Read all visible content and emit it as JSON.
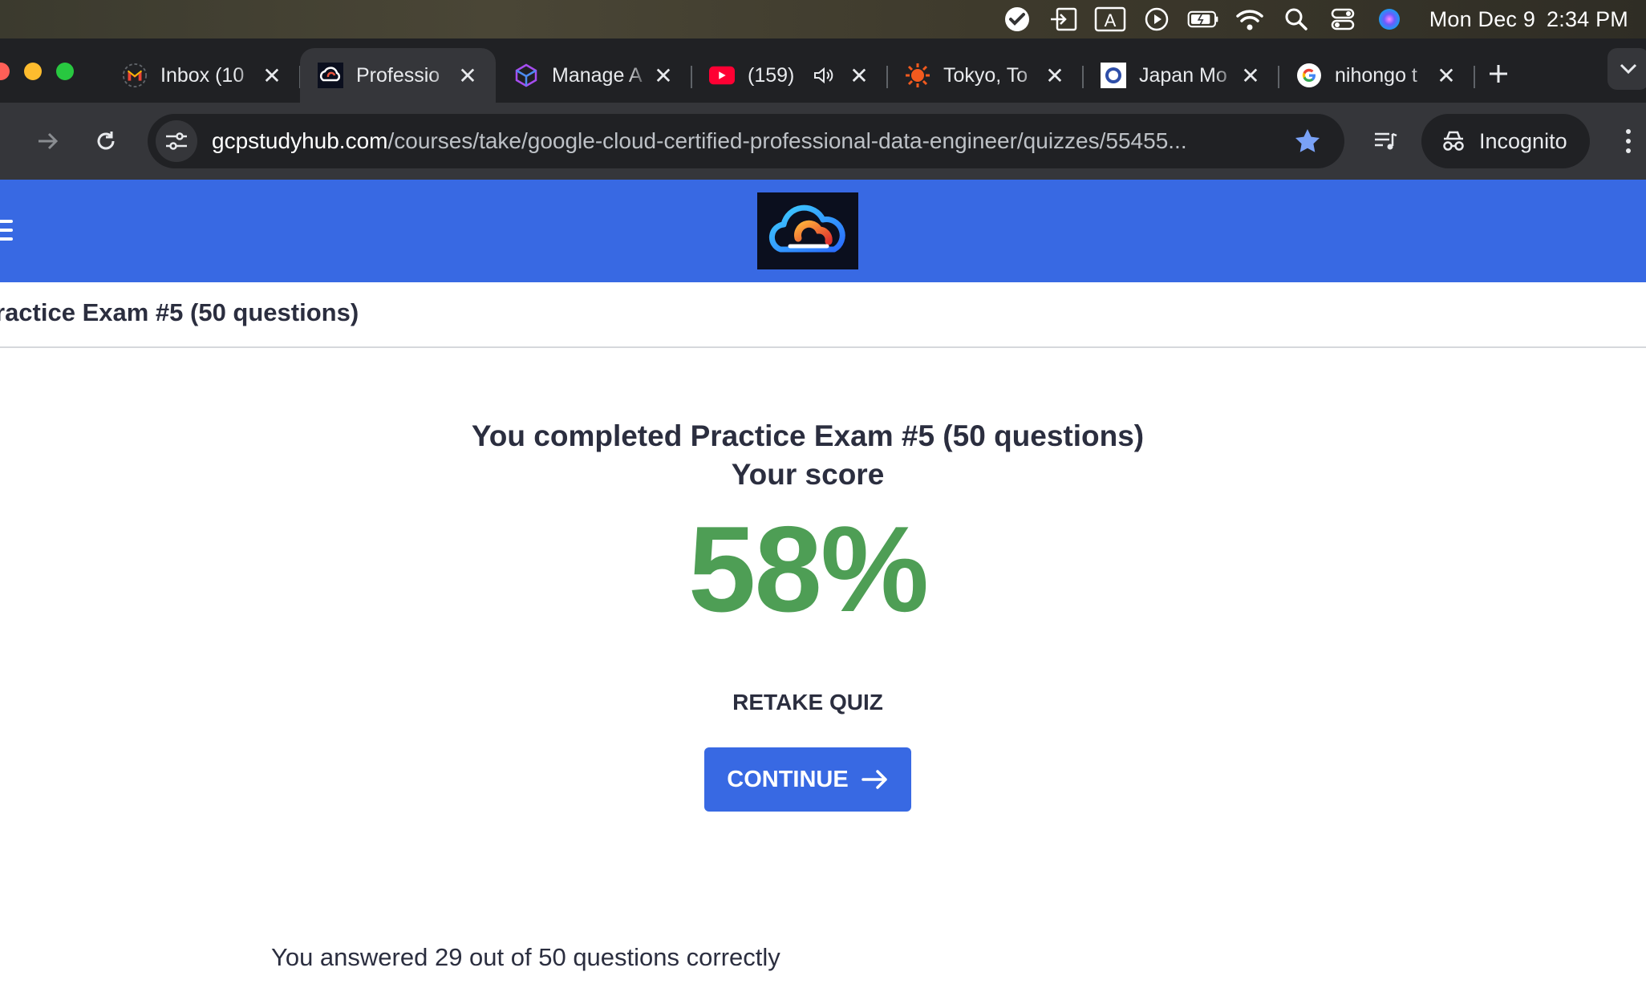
{
  "menubar": {
    "icons": [
      "checkmark-icon",
      "screen-share-icon",
      "input-source-icon",
      "play-icon",
      "battery-icon",
      "wifi-icon",
      "spotlight-icon",
      "control-center-icon",
      "siri-icon"
    ],
    "input_source_label": "A",
    "date": "Mon Dec 9",
    "time": "2:34 PM"
  },
  "tabs": [
    {
      "label": "Inbox (10",
      "favicon": "gmail-icon",
      "active": false
    },
    {
      "label": "Professio",
      "favicon": "gcp-study-hub-icon",
      "active": true
    },
    {
      "label": "Manage A",
      "favicon": "cube-icon",
      "active": false
    },
    {
      "label": "(159)",
      "favicon": "youtube-icon",
      "active": false,
      "audio": true
    },
    {
      "label": "Tokyo, To",
      "favicon": "sun-icon",
      "active": false
    },
    {
      "label": "Japan Mo",
      "favicon": "japan-site-icon",
      "active": false
    },
    {
      "label": "nihongo t",
      "favicon": "google-icon",
      "active": false
    }
  ],
  "toolbar": {
    "url_host": "gcpstudyhub.com",
    "url_path": "/courses/take/google-cloud-certified-professional-data-engineer/quizzes/55455...",
    "incognito_label": "Incognito"
  },
  "quiz": {
    "title": "ractice Exam #5 (50 questions)",
    "completed_text": "You completed Practice Exam #5 (50 questions)",
    "your_score_label": "Your score",
    "score": "58%",
    "retake_label": "RETAKE QUIZ",
    "continue_label": "CONTINUE",
    "answered_text": "You answered 29 out of 50 questions correctly"
  },
  "colors": {
    "brand_blue": "#3869e3",
    "score_green": "#4e9e55",
    "text_dark": "#2b2e3f",
    "chrome_dark": "#202124",
    "chrome_toolbar": "#35363a"
  }
}
